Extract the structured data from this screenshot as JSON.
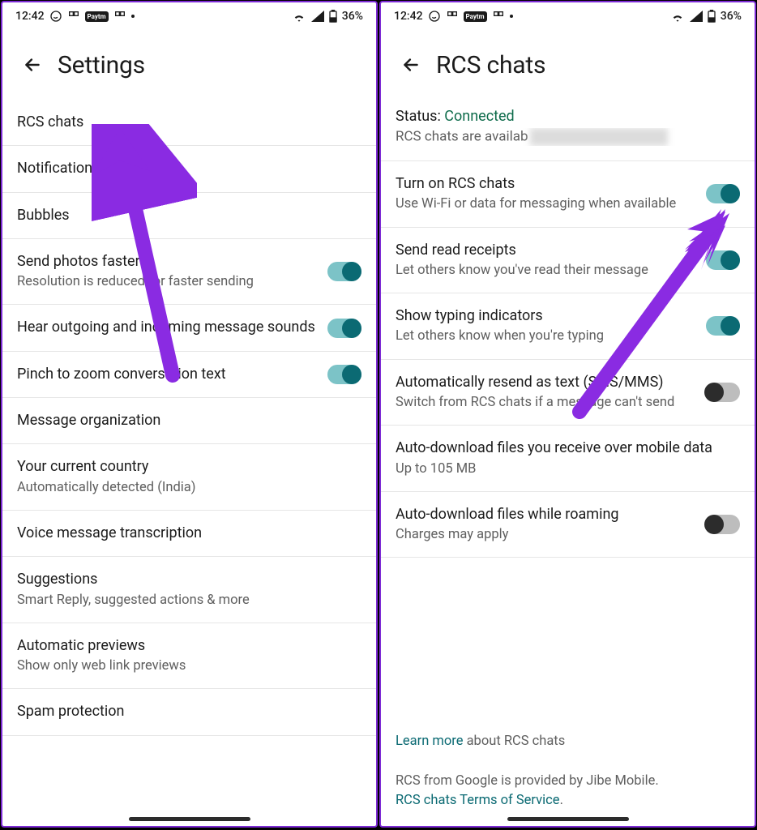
{
  "statusbar": {
    "time": "12:42",
    "battery": "36%",
    "icons_left": [
      "whatsapp",
      "app",
      "paytm",
      "app",
      "dot"
    ],
    "icons_right": [
      "wifi",
      "signal",
      "battery"
    ]
  },
  "left": {
    "title": "Settings",
    "rows": [
      {
        "title": "RCS chats"
      },
      {
        "title": "Notifications"
      },
      {
        "title": "Bubbles"
      },
      {
        "title": "Send photos faster",
        "sub": "Resolution is reduced for faster sending",
        "toggle": "on"
      },
      {
        "title": "Hear outgoing and incoming message sounds",
        "toggle": "on"
      },
      {
        "title": "Pinch to zoom conversation text",
        "toggle": "on"
      },
      {
        "title": "Message organization"
      },
      {
        "title": "Your current country",
        "sub": "Automatically detected (India)"
      },
      {
        "title": "Voice message transcription"
      },
      {
        "title": "Suggestions",
        "sub": "Smart Reply, suggested actions & more"
      },
      {
        "title": "Automatic previews",
        "sub": "Show only web link previews"
      },
      {
        "title": "Spam protection"
      }
    ]
  },
  "right": {
    "title": "RCS chats",
    "status_label": "Status: ",
    "status_value": "Connected",
    "status_sub": "RCS chats are availab",
    "rows": [
      {
        "title": "Turn on RCS chats",
        "sub": "Use Wi-Fi or data for messaging when available",
        "toggle": "on"
      },
      {
        "title": "Send read receipts",
        "sub": "Let others know you've read their message",
        "toggle": "on"
      },
      {
        "title": "Show typing indicators",
        "sub": "Let others know when you're typing",
        "toggle": "on"
      },
      {
        "title": "Automatically resend as text (SMS/MMS)",
        "sub": "Switch from RCS chats if a message can't send",
        "toggle": "off"
      },
      {
        "title": "Auto-download files you receive over mobile data",
        "sub": "Up to 105 MB"
      },
      {
        "title": "Auto-download files while roaming",
        "sub": "Charges may apply",
        "toggle": "off"
      }
    ],
    "footer": {
      "learn_link": "Learn more",
      "learn_rest": " about RCS chats",
      "provider": "RCS from Google is provided by Jibe Mobile.",
      "tos_link": "RCS chats Terms of Service",
      "tos_rest": "."
    }
  },
  "annotations": {
    "arrow_color": "#8a2be2"
  }
}
